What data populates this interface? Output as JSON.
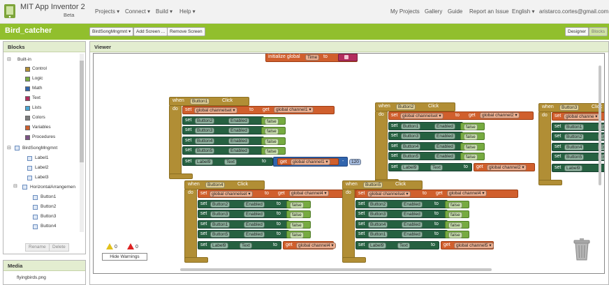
{
  "app": {
    "name": "MIT App Inventor 2",
    "badge": "Beta"
  },
  "nav": {
    "projects": "Projects ▾",
    "connect": "Connect ▾",
    "build": "Build ▾",
    "help": "Help ▾",
    "my_projects": "My Projects",
    "gallery": "Gallery",
    "guide": "Guide",
    "report": "Report an Issue",
    "language": "English ▾",
    "user": "aristarco.cortes@gmail.com ▾"
  },
  "project": {
    "name": "Bird_catcher",
    "screen_select": "BirdSongMngmnt ▾",
    "add_screen": "Add Screen ...",
    "remove_screen": "Remove Screen",
    "designer": "Designer",
    "blocks": "Blocks"
  },
  "blocks_panel": {
    "title": "Blocks",
    "builtin": "Built-in",
    "builtin_items": [
      {
        "label": "Control",
        "color": "#b18e35"
      },
      {
        "label": "Logic",
        "color": "#77ab41"
      },
      {
        "label": "Math",
        "color": "#3165ad"
      },
      {
        "label": "Text",
        "color": "#b32d5e"
      },
      {
        "label": "Lists",
        "color": "#49a6d4"
      },
      {
        "label": "Colors",
        "color": "#7d7d7d"
      },
      {
        "label": "Variables",
        "color": "#d05f2d"
      },
      {
        "label": "Procedures",
        "color": "#7c5385"
      }
    ],
    "screen": "BirdSongMngmnt",
    "components": [
      "Label1",
      "Label2",
      "Label3"
    ],
    "arrangement": "HorizontalArrangemen",
    "buttons": [
      "Button1",
      "Button2",
      "Button3",
      "Button4"
    ],
    "rename": "Rename",
    "delete": "Delete"
  },
  "media_panel": {
    "title": "Media",
    "file": "flyingbirds.png"
  },
  "viewer": {
    "title": "Viewer",
    "init_block": {
      "init": "initialize global",
      "name": "Time",
      "to": "to"
    },
    "kw": {
      "when": "when",
      "do": "do",
      "set": "set",
      "to": "to",
      "get": "get",
      "click": "Click",
      "enabled": "Enabled",
      "text": "Text",
      "global": "global"
    },
    "event_blocks": [
      {
        "component": "Button1",
        "channel": "channelset",
        "get": "channel1",
        "buttons": [
          "Button2",
          "Button3",
          "Button4",
          "Button5"
        ],
        "label": "Label9",
        "math_get": "channel1",
        "math_op": "-",
        "math_num": "120"
      },
      {
        "component": "Button2",
        "channel": "channelset",
        "get": "channel2",
        "buttons": [
          "Button1",
          "Button3",
          "Button4",
          "Button5"
        ],
        "label": "Label9",
        "label_get": "channel2"
      },
      {
        "component": "Button3",
        "channel": "channe",
        "buttons": [
          "Button1",
          "Button2",
          "Button4",
          "Button5"
        ],
        "label": "Label9"
      },
      {
        "component": "Button4",
        "channel": "channelset",
        "get": "channel4",
        "buttons": [
          "Button2",
          "Button3",
          "Button1",
          "Button5"
        ],
        "label": "Label9",
        "label_get": "channel4"
      },
      {
        "component": "Button5",
        "channel": "channelset",
        "get": "channel4",
        "buttons": [
          "Button2",
          "Button3",
          "Button4",
          "Button1"
        ],
        "label": "Label9",
        "label_get": "channel5"
      }
    ],
    "bool_value": "false",
    "warnings": {
      "count": "0",
      "errors": "0",
      "button": "Hide Warnings"
    }
  }
}
